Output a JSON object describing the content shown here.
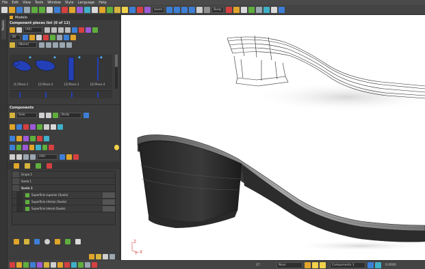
{
  "menu": [
    "File",
    "Edit",
    "View",
    "Tools",
    "Window",
    "Style",
    "Language",
    "Help"
  ],
  "toolbar": {
    "zoom_label": "zoom",
    "body_label": "Body"
  },
  "left_tab": {
    "label": "Modelo"
  },
  "panel": {
    "pieces_title": "Component pieces list (0 of 12)",
    "filter_value": "(All)",
    "view_mode": "3D",
    "none_value": "(None)",
    "pieces": [
      {
        "label": "[1] Piece 1"
      },
      {
        "label": "[2] Piece 2"
      },
      {
        "label": "[3] Piece 3"
      },
      {
        "label": "[4] Piece 4"
      }
    ],
    "components_title": "Components",
    "sole_value": "Sole",
    "body_value": "Body",
    "tree_filter": "(All)",
    "tree": [
      {
        "label": "Grupo 1",
        "kind": "group"
      },
      {
        "label": "Suela 1",
        "kind": "group"
      },
      {
        "label": "Suela 1",
        "kind": "bold"
      },
      {
        "label": "Superficie superior (Suela)",
        "kind": "surface"
      },
      {
        "label": "Superficie inferior (Suela)",
        "kind": "surface"
      },
      {
        "label": "Superficie lateral (Suela)",
        "kind": "surface"
      }
    ]
  },
  "status": {
    "value_27": "27",
    "near": "Near",
    "component": "Components 1",
    "coord": "0.0000"
  },
  "axis": {
    "z": "Z",
    "x": "X",
    "y": "Y"
  }
}
